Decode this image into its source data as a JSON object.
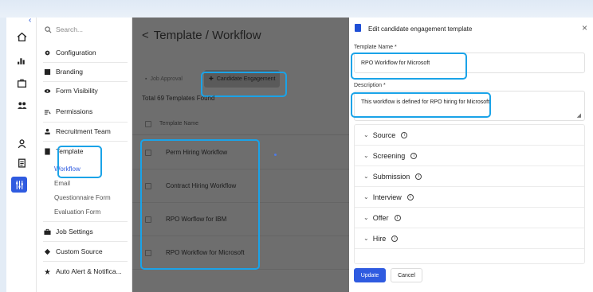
{
  "menu": {
    "search_placeholder": "Search...",
    "items": [
      {
        "label": "Configuration",
        "icon": "gear-icon"
      },
      {
        "label": "Branding",
        "icon": "branding-icon"
      },
      {
        "label": "Form Visibility",
        "icon": "eye-icon"
      },
      {
        "label": "Permissions",
        "icon": "permissions-icon"
      },
      {
        "label": "Recruitment Team",
        "icon": "person-icon"
      },
      {
        "label": "Template",
        "icon": "document-icon"
      }
    ],
    "sub_items": [
      "Workflow",
      "Email",
      "Questionnaire Form",
      "Evaluation Form"
    ],
    "lower_items": [
      {
        "label": "Job Settings",
        "icon": "briefcase-icon"
      },
      {
        "label": "Custom Source",
        "icon": "source-icon"
      },
      {
        "label": "Auto Alert & Notifica...",
        "icon": "alert-icon"
      }
    ]
  },
  "page": {
    "back_symbol": "<",
    "title": "Template / Workflow",
    "tabs": [
      "Job Approval",
      "Candidate Engagement"
    ],
    "total": "Total 69 Templates Found",
    "column_header": "Template Name",
    "rows": [
      "Perm Hiring Workflow",
      "Contract Hiring Workflow",
      "RPO Worflow for IBM",
      "RPO Workflow for Microsoft"
    ]
  },
  "drawer": {
    "title": "Edit candidate engagement template",
    "close_symbol": "×",
    "name_label": "Template Name *",
    "name_value": "RPO Workflow for Microsoft",
    "desc_label": "Description *",
    "desc_value": "This workflow is defined for RPO hiring for Microsoft.",
    "sections": [
      "Source",
      "Screening",
      "Submission",
      "Interview",
      "Offer",
      "Hire"
    ],
    "update_label": "Update",
    "cancel_label": "Cancel"
  },
  "colors": {
    "accent": "#2f5be0",
    "highlight": "#1aa3e8"
  }
}
